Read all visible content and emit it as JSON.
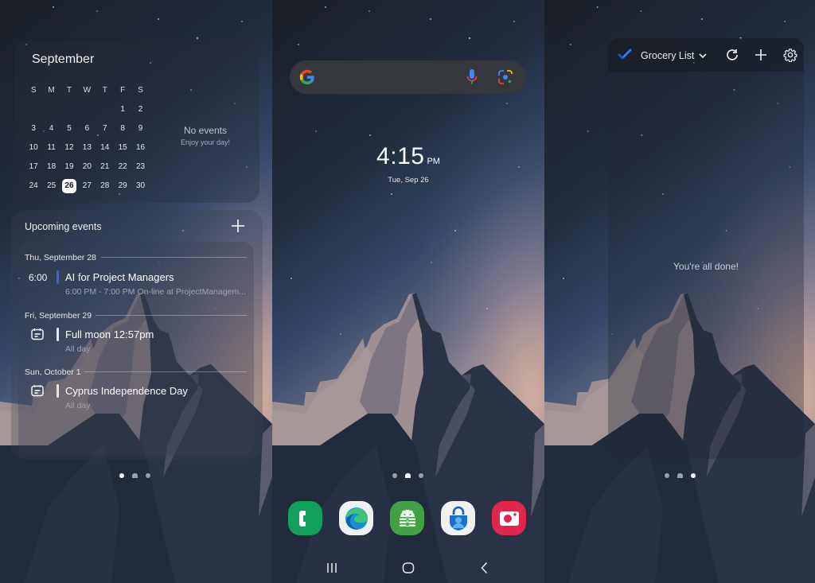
{
  "panels": {
    "left": {
      "calendar": {
        "month": "September",
        "weekdays": [
          "S",
          "M",
          "T",
          "W",
          "T",
          "F",
          "S"
        ],
        "weeks": [
          [
            "",
            "",
            "",
            "",
            "",
            "1",
            "2"
          ],
          [
            "3",
            "4",
            "5",
            "6",
            "7",
            "8",
            "9"
          ],
          [
            "10",
            "11",
            "12",
            "13",
            "14",
            "15",
            "16"
          ],
          [
            "17",
            "18",
            "19",
            "20",
            "21",
            "22",
            "23"
          ],
          [
            "24",
            "25",
            "26",
            "27",
            "28",
            "29",
            "30"
          ]
        ],
        "today": "26",
        "no_events": "No events",
        "no_events_sub": "Enjoy your day!"
      },
      "upcoming": {
        "title": "Upcoming events",
        "add_icon": "plus-icon",
        "days": [
          {
            "header": "Thu, September 28",
            "events": [
              {
                "time": "6:00",
                "icon": null,
                "bar_color": "#3d66c9",
                "title": "AI for Project Managers",
                "subtitle": "6:00 PM - 7:00 PM On-line at ProjectManagem..."
              }
            ]
          },
          {
            "header": "Fri, September 29",
            "events": [
              {
                "time": null,
                "icon": "calendar-note-icon",
                "bar_color": "#e9e6f2",
                "title": "Full moon 12:57pm",
                "subtitle": "All day"
              }
            ]
          },
          {
            "header": "Sun, October 1",
            "events": [
              {
                "time": null,
                "icon": "calendar-note-icon",
                "bar_color": "#f4e2cc",
                "title": "Cyprus Independence Day",
                "subtitle": "All day"
              }
            ]
          }
        ]
      },
      "page_indicator": {
        "count": 3,
        "active": 0
      }
    },
    "center": {
      "search": {
        "logo": "google-g-icon",
        "mic_icon": "microphone-icon",
        "lens_icon": "google-lens-icon"
      },
      "clock": {
        "time": "4:15",
        "ampm": "PM",
        "date": "Tue, Sep 26"
      },
      "page_indicator": {
        "count": 3,
        "active": 1
      },
      "dock": [
        {
          "name": "Phone",
          "icon": "phone-icon",
          "color": "#12a05c"
        },
        {
          "name": "Microsoft Edge",
          "icon": "edge-icon",
          "color": "#f0f0f0"
        },
        {
          "name": "Keepass2Android",
          "icon": "keepass-android-icon",
          "color": "#43a047"
        },
        {
          "name": "Microsoft Authenticator",
          "icon": "authenticator-icon",
          "color": "#f0f0f0"
        },
        {
          "name": "Screen Recorder",
          "icon": "camera-icon",
          "color": "#e0254f"
        }
      ],
      "nav": {
        "recents": "recents-icon",
        "home": "home-icon",
        "back": "back-icon"
      }
    },
    "right": {
      "todo": {
        "list_name": "Grocery List",
        "empty_message": "You're all done!",
        "accent": "#2f7fe0"
      },
      "page_indicator": {
        "count": 3,
        "active": 2
      }
    }
  }
}
